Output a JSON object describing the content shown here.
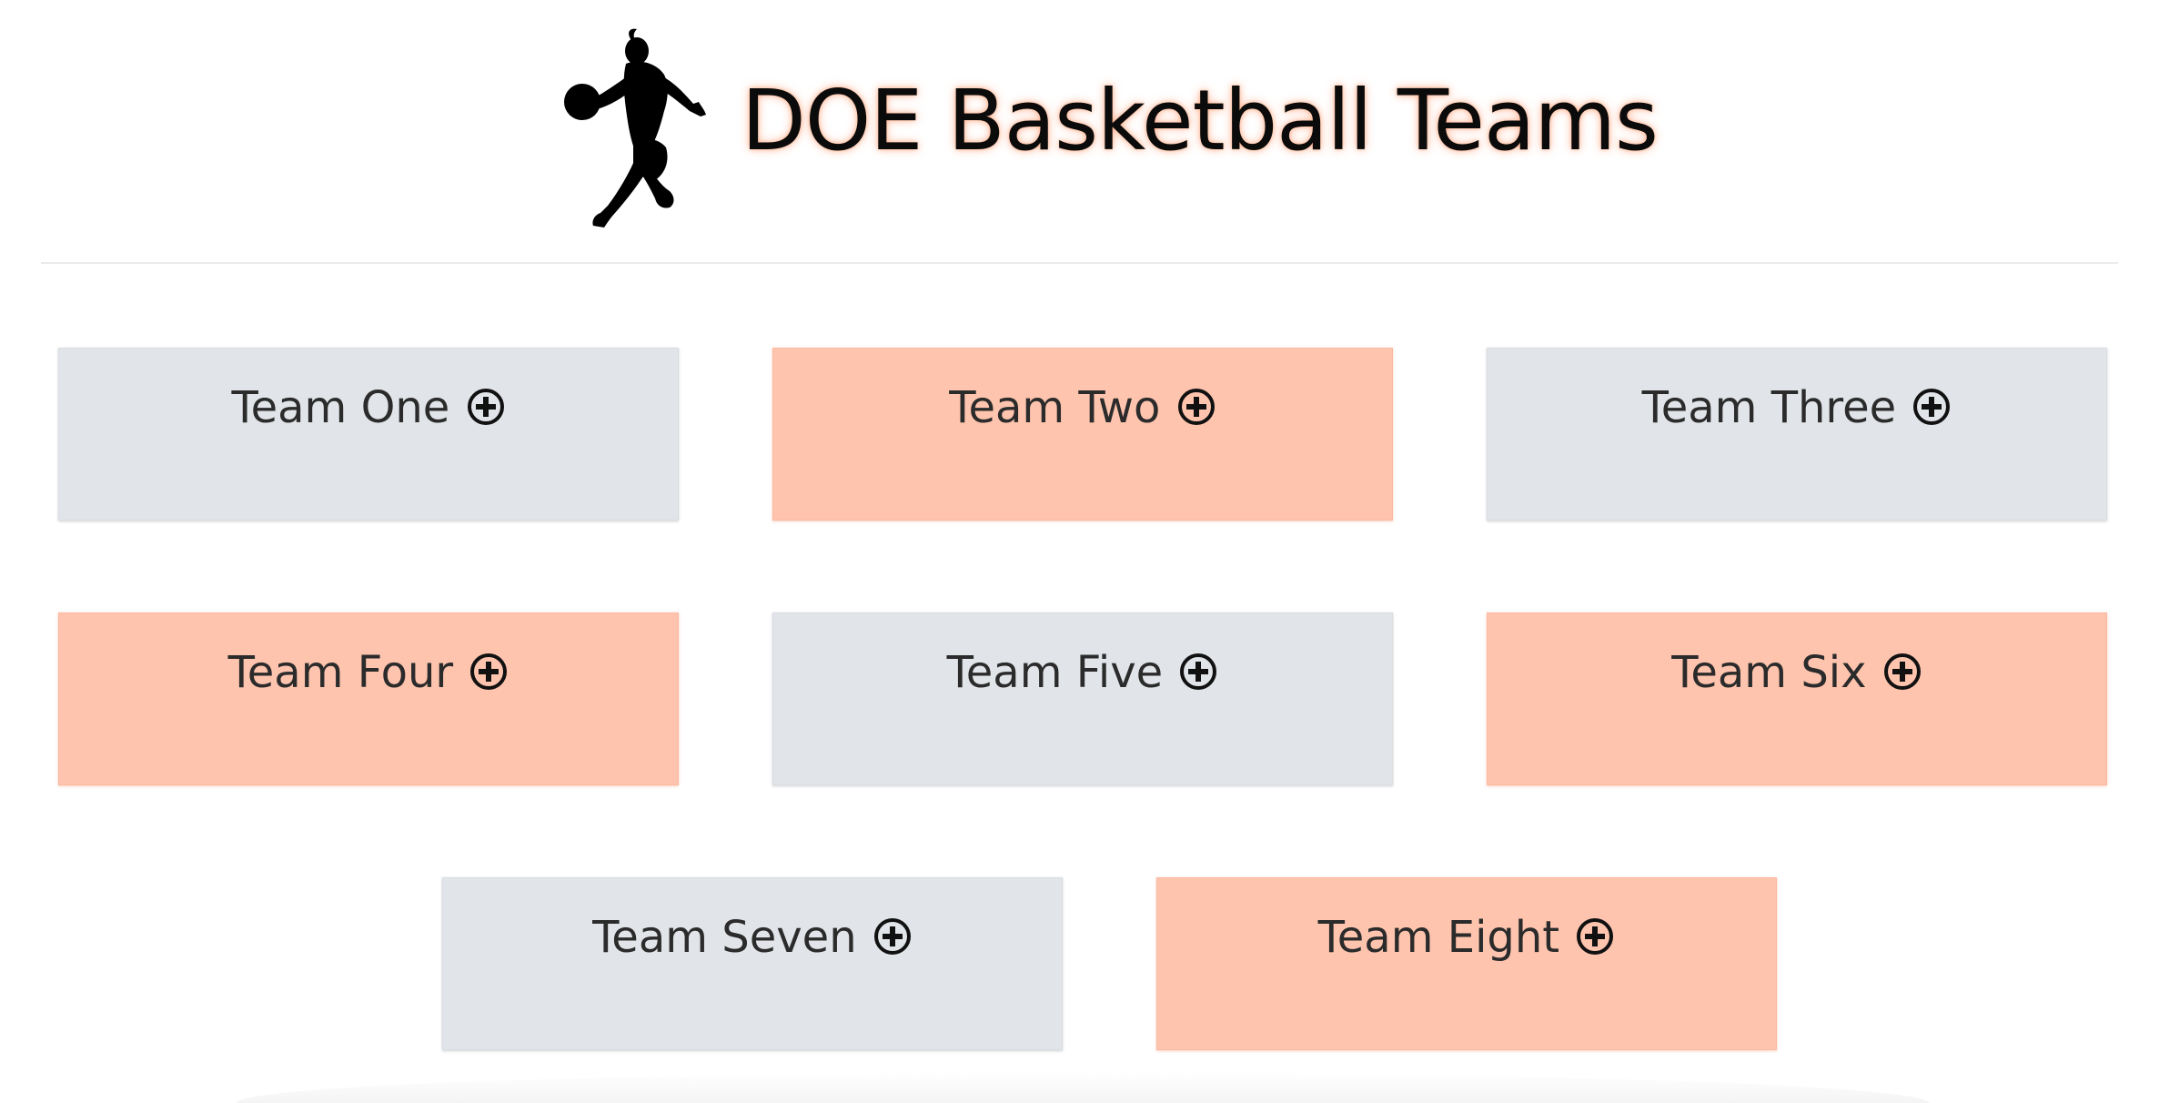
{
  "header": {
    "title": "DOE Basketball Teams",
    "logo_icon": "basketball-player-silhouette-icon"
  },
  "teams": [
    {
      "label": "Team One",
      "color": "#e1e5e9",
      "icon": "plus-circle-icon"
    },
    {
      "label": "Team Two",
      "color": "#ffc4ae",
      "icon": "plus-circle-icon"
    },
    {
      "label": "Team Three",
      "color": "#e1e5e9",
      "icon": "plus-circle-icon"
    },
    {
      "label": "Team Four",
      "color": "#ffc4ae",
      "icon": "plus-circle-icon"
    },
    {
      "label": "Team Five",
      "color": "#e1e5e9",
      "icon": "plus-circle-icon"
    },
    {
      "label": "Team Six",
      "color": "#ffc4ae",
      "icon": "plus-circle-icon"
    },
    {
      "label": "Team Seven",
      "color": "#e1e5e9",
      "icon": "plus-circle-icon"
    },
    {
      "label": "Team Eight",
      "color": "#ffc4ae",
      "icon": "plus-circle-icon"
    }
  ],
  "colors": {
    "accent_peach": "#ffc4ae",
    "neutral_gray": "#e1e5e9",
    "title_glow": "#ff8c5a"
  }
}
